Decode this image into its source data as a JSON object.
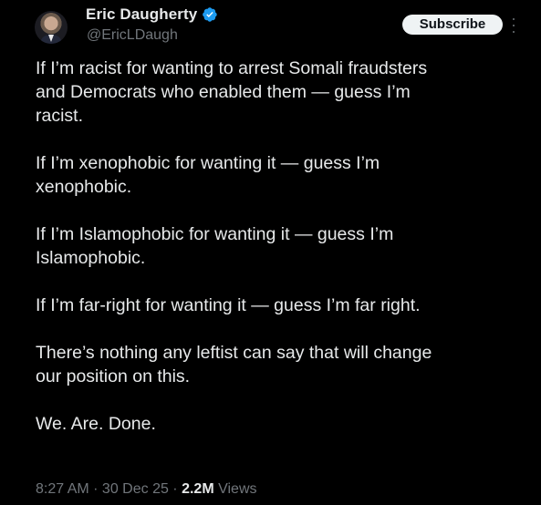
{
  "author": {
    "display_name": "Eric Daugherty",
    "handle": "@EricLDaugh",
    "verified": true,
    "avatar_icon": "profile-photo"
  },
  "actions": {
    "subscribe_label": "Subscribe",
    "more_icon": "more-vertical-icon"
  },
  "tweet": {
    "paragraphs": [
      "If I’m racist for wanting to arrest Somali fraudsters\nand Democrats who enabled them — guess I’m\nracist.",
      "If I’m xenophobic for wanting it — guess I’m\nxenophobic.",
      "If I’m Islamophobic for wanting it — guess I’m\nIslamophobic.",
      "If I’m far-right for wanting it — guess I’m far right.",
      "There’s nothing any leftist can say that will change\nour position on this.",
      "We. Are. Done."
    ],
    "time": "8:27 AM",
    "separator": " · ",
    "date": "30 Dec 25",
    "views_count": "2.2M",
    "views_label": " Views"
  },
  "colors": {
    "background": "#000000",
    "text_primary": "#e7e9ea",
    "text_secondary": "#71767b",
    "verified_blue": "#1d9bf0",
    "button_bg": "#eff3f4"
  }
}
